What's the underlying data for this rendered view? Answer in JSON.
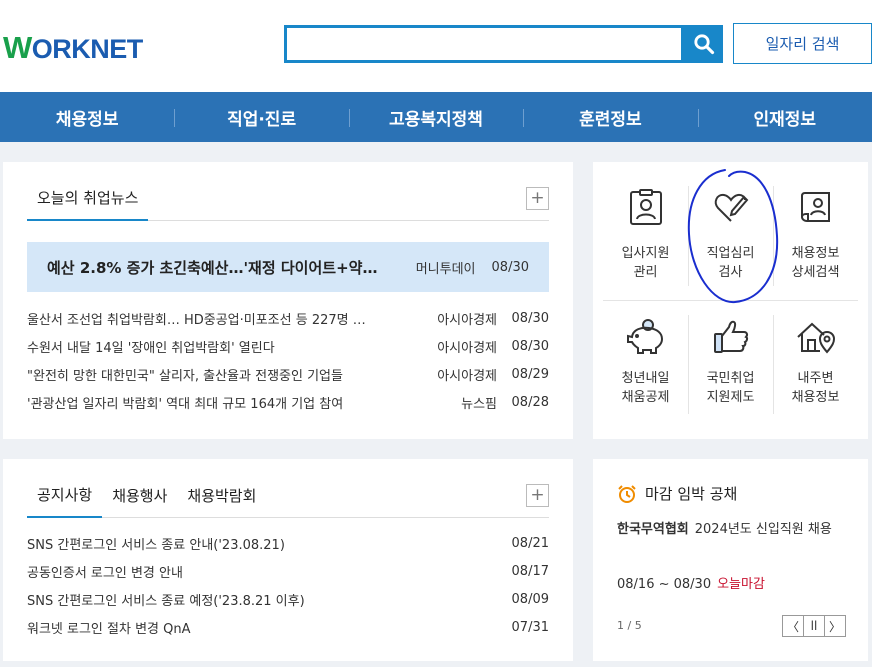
{
  "header": {
    "logo_text_w": "W",
    "logo_text_rest": "ORKNET",
    "search_placeholder": "",
    "job_search_button": "일자리 검색"
  },
  "nav": [
    "채용정보",
    "직업·진로",
    "고용복지정책",
    "훈련정보",
    "인재정보"
  ],
  "news": {
    "tab": "오늘의 취업뉴스",
    "more": "+",
    "headline": {
      "title": "예산 2.8% 증가 초긴축예산…'재정 다이어트+약…",
      "source": "머니투데이",
      "date": "08/30"
    },
    "items": [
      {
        "title": "울산서 조선업 취업박람회… HD중공업·미포조선 등 227명 …",
        "source": "아시아경제",
        "date": "08/30"
      },
      {
        "title": "수원서 내달 14일 '장애인 취업박람회' 열린다",
        "source": "아시아경제",
        "date": "08/30"
      },
      {
        "title": "\"완전히 망한 대한민국\" 살리자, 출산율과 전쟁중인 기업들",
        "source": "아시아경제",
        "date": "08/29"
      },
      {
        "title": "'관광산업 일자리 박람회' 역대 최대 규모 164개 기업 참여",
        "source": "뉴스핌",
        "date": "08/28"
      }
    ]
  },
  "notice": {
    "tabs": [
      "공지사항",
      "채용행사",
      "채용박람회"
    ],
    "more": "+",
    "items": [
      {
        "title": "SNS 간편로그인 서비스 종료 안내('23.08.21)",
        "date": "08/21"
      },
      {
        "title": "공동인증서 로그인 변경 안내",
        "date": "08/17"
      },
      {
        "title": "SNS 간편로그인 서비스 종료 예정('23.8.21 이후)",
        "date": "08/09"
      },
      {
        "title": "워크넷 로그인 절차 변경 QnA",
        "date": "07/31"
      }
    ]
  },
  "services": [
    {
      "label": "입사지원\n관리",
      "icon": "document-person-icon"
    },
    {
      "label": "직업심리\n검사",
      "icon": "heart-pen-icon"
    },
    {
      "label": "채용정보\n상세검색",
      "icon": "scroll-person-icon"
    },
    {
      "label": "청년내일\n채움공제",
      "icon": "piggy-bank-icon"
    },
    {
      "label": "국민취업\n지원제도",
      "icon": "thumbs-up-icon"
    },
    {
      "label": "내주변\n채용정보",
      "icon": "house-pin-icon"
    }
  ],
  "deadline": {
    "title": "마감 임박 공채",
    "company": "한국무역협회",
    "job": "2024년도 신입직원 채용",
    "dates": "08/16 ~ 08/30",
    "badge": "오늘마감",
    "page": "1 / 5",
    "prev": "〈",
    "pause": "ll",
    "next": "〉"
  },
  "colors": {
    "brand_blue": "#2b72b5",
    "search_blue": "#1887c9",
    "logo_green": "#19a04b",
    "deadline_red": "#c8102e",
    "headline_bg": "#d5e7f8"
  }
}
